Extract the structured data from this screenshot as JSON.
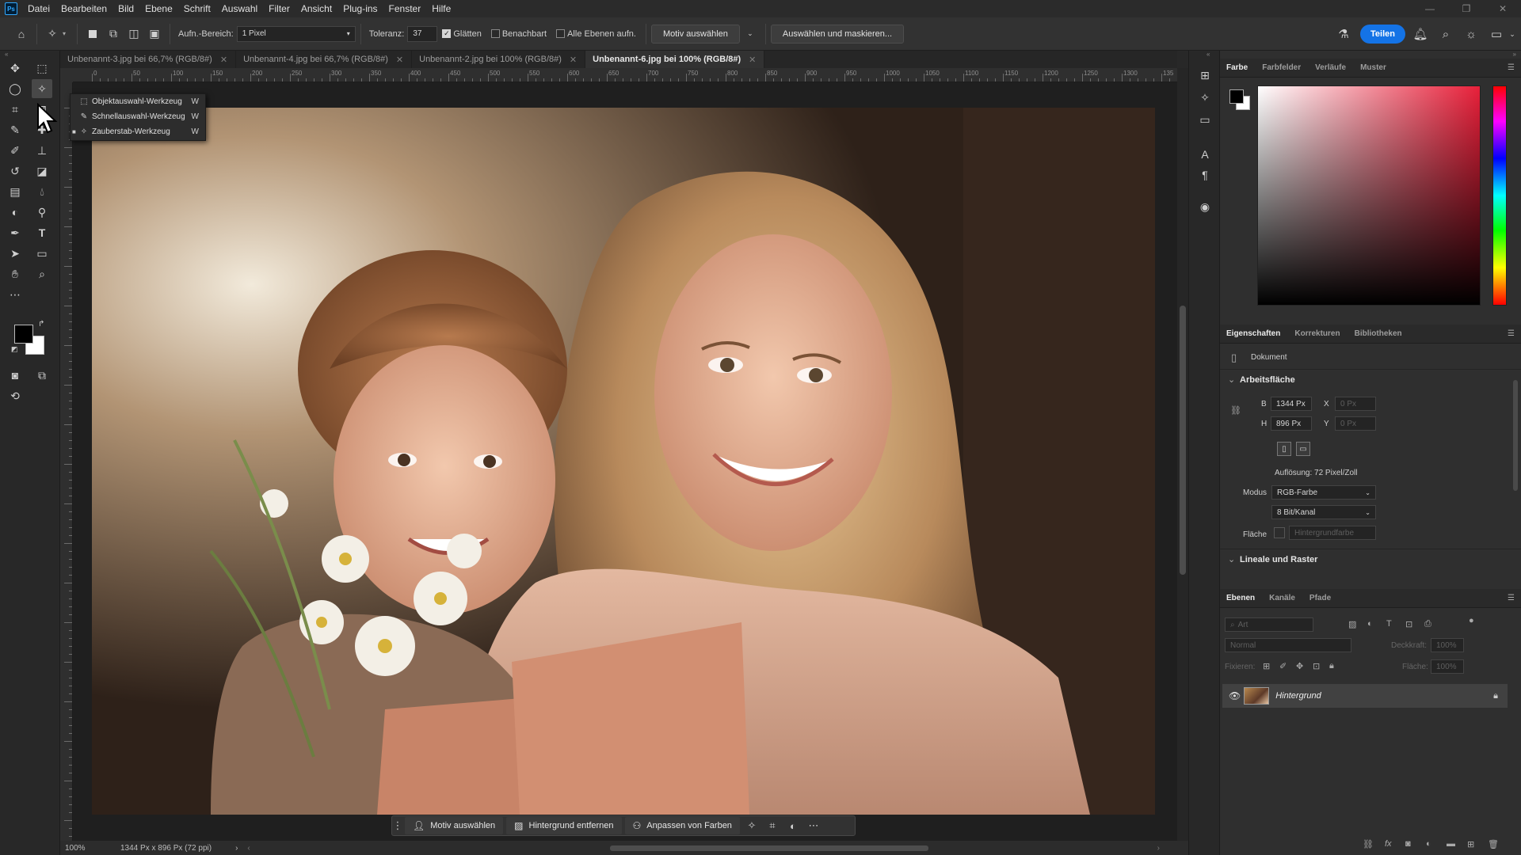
{
  "menubar": {
    "logo": "Ps",
    "items": [
      "Datei",
      "Bearbeiten",
      "Bild",
      "Ebene",
      "Schrift",
      "Auswahl",
      "Filter",
      "Ansicht",
      "Plug-ins",
      "Fenster",
      "Hilfe"
    ]
  },
  "options": {
    "sample_label": "Aufn.-Bereich:",
    "sample_value": "1 Pixel",
    "tolerance_label": "Toleranz:",
    "tolerance_value": "37",
    "smooth_label": "Glätten",
    "contiguous_label": "Benachbart",
    "all_layers_label": "Alle Ebenen aufn.",
    "select_subject": "Motiv auswählen",
    "select_and_mask": "Auswählen und maskieren...",
    "share": "Teilen"
  },
  "tabs": [
    {
      "label": "Unbenannt-3.jpg bei 66,7% (RGB/8#)",
      "active": false
    },
    {
      "label": "Unbenannt-4.jpg bei 66,7% (RGB/8#)",
      "active": false
    },
    {
      "label": "Unbenannt-2.jpg bei 100% (RGB/8#)",
      "active": false
    },
    {
      "label": "Unbenannt-6.jpg bei 100% (RGB/8#)",
      "active": true
    }
  ],
  "ruler_labels": [
    "0",
    "50",
    "100",
    "150",
    "200",
    "250",
    "300",
    "350",
    "400",
    "450",
    "500",
    "550",
    "600",
    "650",
    "700",
    "750",
    "800",
    "850",
    "900",
    "950",
    "1000",
    "1050",
    "1100",
    "1150",
    "1200",
    "1250",
    "1300",
    "135"
  ],
  "flyout": {
    "items": [
      {
        "label": "Objektauswahl-Werkzeug",
        "key": "W"
      },
      {
        "label": "Schnellauswahl-Werkzeug",
        "key": "W"
      },
      {
        "label": "Zauberstab-Werkzeug",
        "key": "W"
      }
    ]
  },
  "taskbar": {
    "select_subject": "Motiv auswählen",
    "remove_bg": "Hintergrund entfernen",
    "match_colors": "Anpassen von Farben"
  },
  "status": {
    "zoom": "100%",
    "doc_info": "1344 Px x 896 Px (72 ppi)"
  },
  "color_panel": {
    "tabs": [
      "Farbe",
      "Farbfelder",
      "Verläufe",
      "Muster"
    ]
  },
  "properties": {
    "tabs": [
      "Eigenschaften",
      "Korrekturen",
      "Bibliotheken"
    ],
    "doc_label": "Dokument",
    "canvas_section": "Arbeitsfläche",
    "w_label": "B",
    "w_value": "1344 Px",
    "h_label": "H",
    "h_value": "896 Px",
    "x_label": "X",
    "x_value": "0 Px",
    "y_label": "Y",
    "y_value": "0 Px",
    "resolution": "Auflösung: 72 Pixel/Zoll",
    "mode_label": "Modus",
    "mode_value": "RGB-Farbe",
    "depth_value": "8 Bit/Kanal",
    "fill_label": "Fläche",
    "fill_value": "Hintergrundfarbe",
    "rulers_section": "Lineale und Raster"
  },
  "layers": {
    "tabs": [
      "Ebenen",
      "Kanäle",
      "Pfade"
    ],
    "search_placeholder": "Art",
    "blend_mode": "Normal",
    "opacity_label": "Deckkraft:",
    "opacity_value": "100%",
    "lock_label": "Fixieren:",
    "fill_label": "Fläche:",
    "fill_value": "100%",
    "layer_name": "Hintergrund"
  }
}
